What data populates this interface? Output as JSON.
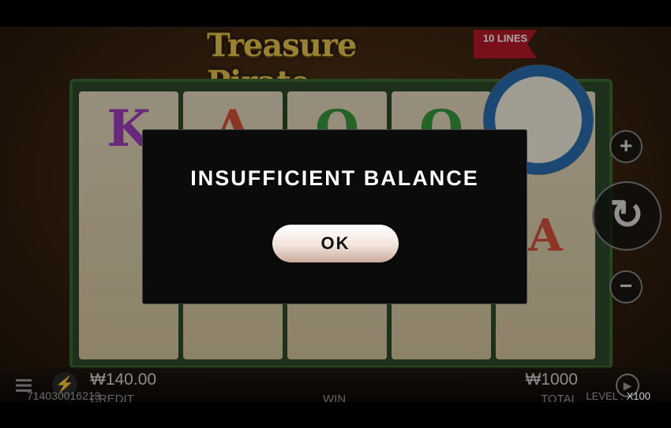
{
  "game": {
    "logo_text": "Treasure Pirate",
    "lines_badge": "10 LINES"
  },
  "reels": [
    {
      "symbols": [
        "K",
        "",
        ""
      ]
    },
    {
      "symbols": [
        "A",
        "",
        ""
      ]
    },
    {
      "symbols": [
        "Q",
        "",
        ""
      ]
    },
    {
      "symbols": [
        "Q",
        "",
        ""
      ]
    },
    {
      "symbols": [
        "",
        "A",
        ""
      ]
    }
  ],
  "controls": {
    "plus": "+",
    "minus": "−",
    "spin": "↻"
  },
  "dialog": {
    "message": "INSUFFICIENT BALANCE",
    "ok_label": "OK"
  },
  "bottom_bar": {
    "credit_value": "₩140.00",
    "credit_label": "CREDIT",
    "win_label": "WIN",
    "total_value": "₩1000",
    "total_label": "TOTAL"
  },
  "footer": {
    "session_id": "714030016213",
    "level_label": "LEVEL :",
    "level_value": "X100"
  },
  "icons": {
    "menu": "menu-icon",
    "turbo": "lightning-icon",
    "autoplay": "autoplay-icon"
  }
}
